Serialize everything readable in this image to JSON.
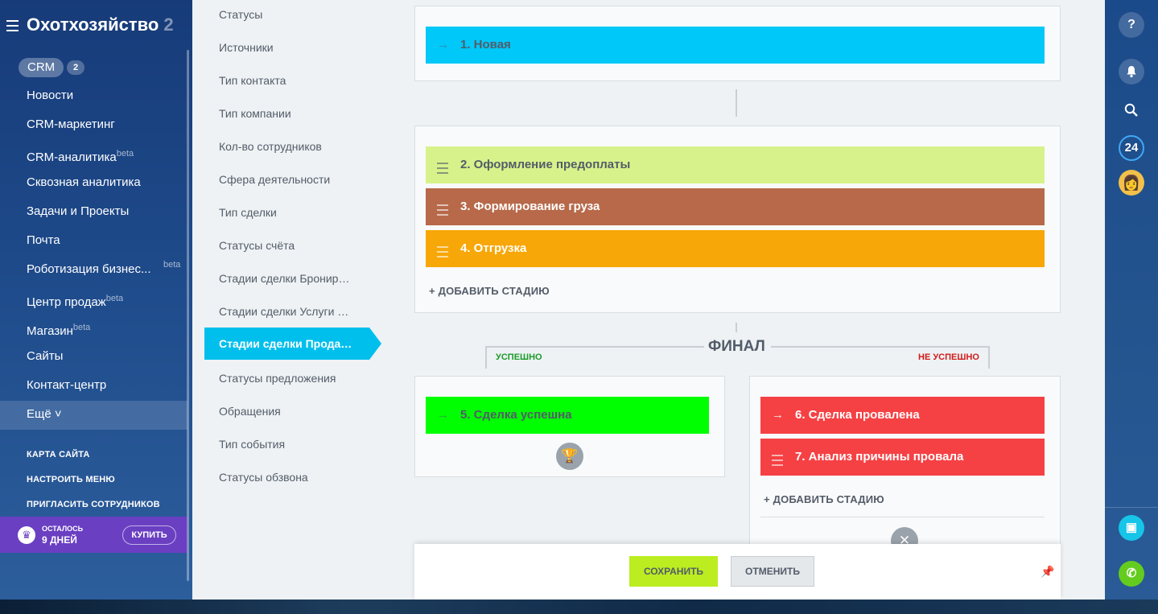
{
  "sidebar": {
    "brand": "Охотхозяйство",
    "brand_fade": " 2",
    "crm_label": "CRM",
    "crm_count": "2",
    "items": [
      {
        "label": "Новости",
        "beta": ""
      },
      {
        "label": "CRM-маркетинг",
        "beta": ""
      },
      {
        "label": "CRM-аналитика",
        "beta": "beta"
      },
      {
        "label": "Сквозная аналитика",
        "beta": ""
      },
      {
        "label": "Задачи и Проекты",
        "beta": ""
      },
      {
        "label": "Почта",
        "beta": ""
      },
      {
        "label": "Роботизация бизнес...",
        "beta": "beta"
      },
      {
        "label": "Центр продаж",
        "beta": "beta"
      },
      {
        "label": "Магазин",
        "beta": "beta"
      },
      {
        "label": "Сайты",
        "beta": ""
      },
      {
        "label": "Контакт-центр",
        "beta": ""
      }
    ],
    "more": "Ещё ˅",
    "sitemap": "КАРТА САЙТА",
    "configure_menu": "НАСТРОИТЬ МЕНЮ",
    "invite": "ПРИГЛАСИТЬ СОТРУДНИКОВ",
    "trial_top": "ОСТАЛОСЬ",
    "trial_bottom": "9 ДНЕЙ",
    "buy": "КУПИТЬ"
  },
  "submenu": {
    "items": [
      "Статусы",
      "Источники",
      "Тип контакта",
      "Тип компании",
      "Кол-во сотрудников",
      "Сфера деятельности",
      "Тип сделки",
      "Статусы счёта",
      "Стадии сделки Бронир…",
      "Стадии сделки Услуги …",
      "Стадии сделки Прода…",
      "Статусы предложения",
      "Обращения",
      "Тип события",
      "Статусы обзвона"
    ],
    "active_index": 10
  },
  "stages": {
    "initial": {
      "label": "1. Новая",
      "color": "#00c8f8"
    },
    "progress": [
      {
        "label": "2. Оформление предоплаты",
        "color": "#d7f28b"
      },
      {
        "label": "3. Формирование груза",
        "color": "#b7694a"
      },
      {
        "label": "4. Отгрузка",
        "color": "#f7a707"
      }
    ],
    "add_stage": "+ ДОБАВИТЬ СТАДИЮ",
    "final_title": "ФИНАЛ",
    "success_label": "УСПЕШНО",
    "fail_label": "НЕ УСПЕШНО",
    "success": {
      "label": "5. Сделка успешна",
      "color": "#00ff00"
    },
    "failure": [
      {
        "label": "6. Сделка провалена",
        "color": "#f54144"
      },
      {
        "label": "7. Анализ причины провала",
        "color": "#f54144"
      }
    ]
  },
  "footer": {
    "save": "СОХРАНИТЬ",
    "cancel": "ОТМЕНИТЬ"
  },
  "right_panel": {
    "help": "?",
    "counter": "24"
  }
}
